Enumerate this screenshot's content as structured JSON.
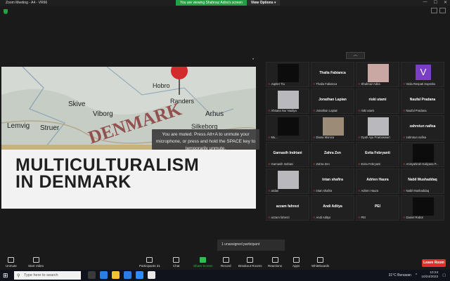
{
  "window": {
    "title": "Zoom Meeting - A4 - VR66",
    "minimize": "—",
    "maximize": "☐",
    "close": "✕"
  },
  "banner": {
    "viewing_text": "You are viewing Shahnaz Adira's screen",
    "view_options": "View Options ▾"
  },
  "slide": {
    "heading_line1": "MULTICULTURALISM",
    "heading_line2": "IN DENMARK",
    "map_labels": [
      "DENMARK",
      "Skive",
      "Viborg",
      "Arhus",
      "Struer",
      "Lemvig",
      "Randers",
      "Silkeborg",
      "Hobro"
    ]
  },
  "muted_tooltip": "You are muted. Press Alt+A to unmute your microphone, or press and hold the SPACE key to temporarily unmute.",
  "collapse_arrow": "︿",
  "participants": [
    {
      "center": "",
      "bottom": "Jupiter Tiu",
      "photo": "dark"
    },
    {
      "center": "Thalia Fabianca",
      "bottom": "Thalia Fabianca"
    },
    {
      "center": "",
      "bottom": "Shahnaz Adira",
      "photo": "pink"
    },
    {
      "center": "",
      "bottom": "Viola Respati Suprobo",
      "letter": "V"
    },
    {
      "center": "",
      "bottom": "Ahsana Nur Nadiya",
      "photo": "grey"
    },
    {
      "center": "Jonathan Lapian",
      "bottom": "Jonathan Lapian"
    },
    {
      "center": "riski utami",
      "bottom": "riski utami"
    },
    {
      "center": "Naufal Pradana",
      "bottom": "Naufal Pradana"
    },
    {
      "center": "",
      "bottom": "Mu...",
      "photo": "dark"
    },
    {
      "center": "",
      "bottom": "Diana Monica",
      "photo": "tan"
    },
    {
      "center": "",
      "bottom": "Dyah Ayu Pramaswari",
      "photo": "grey"
    },
    {
      "center": "zahrotun nafisa",
      "bottom": "zahrotun nafisa"
    },
    {
      "center": "Garnasih Indriani",
      "bottom": "Garnasih Indriani"
    },
    {
      "center": "Zahra Zen",
      "bottom": "Zahra Zen"
    },
    {
      "center": "Evita Febryanti",
      "bottom": "Evita Febryanti"
    },
    {
      "center": "",
      "bottom": "Anisyahirah Kaliyana P...",
      "photo": "dark"
    },
    {
      "center": "",
      "bottom": "ardan",
      "photo": "grey"
    },
    {
      "center": "intan shafira",
      "bottom": "intan shafira"
    },
    {
      "center": "Adrien Haura",
      "bottom": "Adrien Haura"
    },
    {
      "center": "Nabil Mushaddaq",
      "bottom": "Nabil Mushaddaq"
    },
    {
      "center": "azzam fahrezi",
      "bottom": "azzam fahrezi"
    },
    {
      "center": "Andi Aditya",
      "bottom": "Andi Aditya"
    },
    {
      "center": "PEI",
      "bottom": "PEI"
    },
    {
      "center": "",
      "bottom": "Daniel Robot",
      "photo": "dark"
    }
  ],
  "unassigned": "1 unassigned participant",
  "toolbar": {
    "unmute": "Unmute",
    "start_video": "Start Video",
    "participants": "Participants",
    "participants_count": "31",
    "chat": "Chat",
    "share": "Share Screen",
    "record": "Record",
    "breakout": "Breakout Rooms",
    "reactions": "Reactions",
    "apps": "Apps",
    "whiteboards": "Whiteboards",
    "leave": "Leave Room"
  },
  "taskbar": {
    "search_placeholder": "Type here to search",
    "weather": "31°C Berawan",
    "time": "10:24",
    "date": "10/24/2022"
  }
}
